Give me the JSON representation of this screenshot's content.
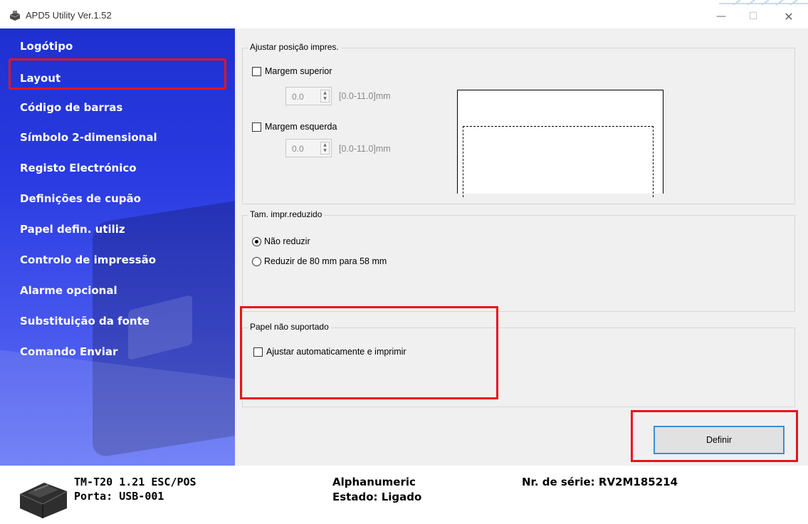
{
  "window": {
    "title": "APD5 Utility Ver.1.52",
    "controls": {
      "minimize": "—",
      "maximize": "☐",
      "close": "✕"
    }
  },
  "sidebar": {
    "items": [
      {
        "label": "Logótipo",
        "selected": false
      },
      {
        "label": "Layout",
        "selected": true
      },
      {
        "label": "Código de barras",
        "selected": false
      },
      {
        "label": "Símbolo 2-dimensional",
        "selected": false
      },
      {
        "label": "Registo Electrónico",
        "selected": false
      },
      {
        "label": "Definições de cupão",
        "selected": false
      },
      {
        "label": "Papel defin. utiliz",
        "selected": false
      },
      {
        "label": "Controlo de impressão",
        "selected": false
      },
      {
        "label": "Alarme opcional",
        "selected": false
      },
      {
        "label": "Substituição da fonte",
        "selected": false
      },
      {
        "label": "Comando Enviar",
        "selected": false
      }
    ]
  },
  "print_position": {
    "title": "Ajustar posição impres.",
    "top_margin": {
      "label": "Margem superior",
      "checked": false,
      "value": "0.0",
      "range": "[0.0-11.0]mm"
    },
    "left_margin": {
      "label": "Margem esquerda",
      "checked": false,
      "value": "0.0",
      "range": "[0.0-11.0]mm"
    }
  },
  "reduced_print": {
    "title": "Tam. impr.reduzido",
    "options": [
      {
        "label": "Não reduzir",
        "selected": true
      },
      {
        "label": "Reduzir de 80 mm para 58 mm",
        "selected": false
      }
    ]
  },
  "unsupported_paper": {
    "title": "Papel não suportado",
    "auto_adjust": {
      "label": "Ajustar automaticamente e imprimir",
      "checked": false
    }
  },
  "define_button": "Definir",
  "status": {
    "model": "TM-T20 1.21 ESC/POS",
    "port": "Porta: USB-001",
    "mode": "Alphanumeric",
    "state": "Estado: Ligado",
    "serial": "Nr. de série: RV2M185214"
  },
  "colors": {
    "sidebar": "#2a3ce2",
    "highlight": "#e8141c",
    "button_focus": "#3c8ed8",
    "panel": "#f0f0f0"
  }
}
